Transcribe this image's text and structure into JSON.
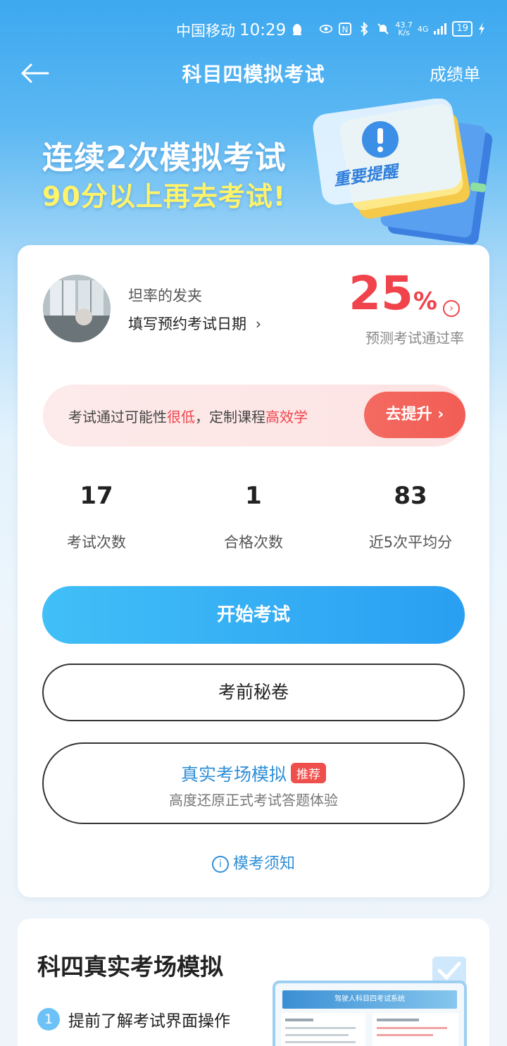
{
  "status_bar": {
    "carrier": "中国移动",
    "time": "10:29",
    "net_speed_value": "43.7",
    "net_speed_unit": "K/s",
    "network": "4G",
    "battery": "19"
  },
  "nav": {
    "title": "科目四模拟考试",
    "right_link": "成绩单"
  },
  "banner": {
    "line1": "连续2次模拟考试",
    "line2": "90分以上再去考试!",
    "badge": "重要提醒"
  },
  "profile": {
    "name": "坦率的发夹",
    "book_date": "填写预约考试日期"
  },
  "pass_rate": {
    "value": "25",
    "unit": "%",
    "label": "预测考试通过率"
  },
  "warning": {
    "part1": "考试通过可能性",
    "part2": "很低",
    "part3": "，定制课程",
    "part4": "高效学",
    "button": "去提升"
  },
  "stats": [
    {
      "value": "17",
      "label": "考试次数"
    },
    {
      "value": "1",
      "label": "合格次数"
    },
    {
      "value": "83",
      "label": "近5次平均分"
    }
  ],
  "buttons": {
    "start": "开始考试",
    "secret": "考前秘卷",
    "real_title": "真实考场模拟",
    "real_tag": "推荐",
    "real_sub": "高度还原正式考试答题体验",
    "notice": "模考须知"
  },
  "section2": {
    "title": "科四真实考场模拟",
    "step1_num": "1",
    "step1": "提前了解考试界面操作",
    "preview_title": "驾驶人科目四考试系统"
  },
  "colors": {
    "brand_blue": "#2a9ff2",
    "accent_red": "#f0434b",
    "banner_yellow": "#fff36a"
  }
}
